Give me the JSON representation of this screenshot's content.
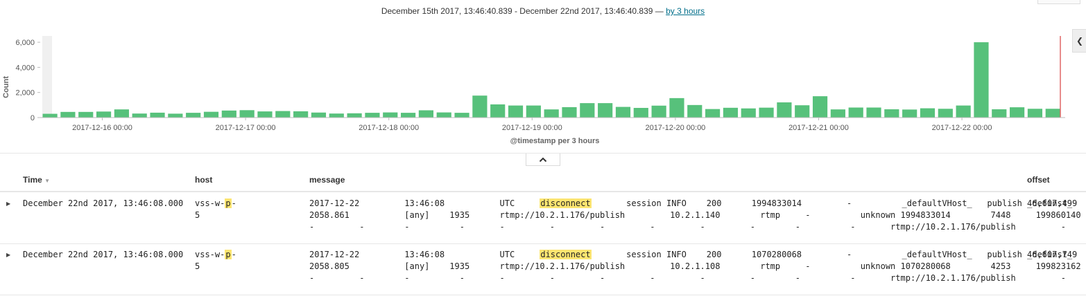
{
  "header": {
    "range_text": "December 15th 2017, 13:46:40.839 - December 22nd 2017, 13:46:40.839 —",
    "interval_link": "by 3 hours"
  },
  "chart_data": {
    "type": "bar",
    "ylabel": "Count",
    "xlabel": "@timestamp per 3 hours",
    "ylim": [
      0,
      6500
    ],
    "yticks": [
      0,
      2000,
      4000,
      6000
    ],
    "ytick_labels": [
      "0",
      "2,000",
      "4,000",
      "6,000"
    ],
    "xtick_labels": [
      "2017-12-16 00:00",
      "2017-12-17 00:00",
      "2017-12-18 00:00",
      "2017-12-19 00:00",
      "2017-12-20 00:00",
      "2017-12-21 00:00",
      "2017-12-22 00:00"
    ],
    "bar_color": "#57c17b",
    "values": [
      300,
      450,
      450,
      480,
      650,
      320,
      390,
      310,
      380,
      460,
      560,
      590,
      490,
      520,
      500,
      400,
      320,
      340,
      380,
      410,
      380,
      580,
      410,
      380,
      1750,
      1050,
      960,
      960,
      650,
      830,
      1150,
      1150,
      850,
      770,
      950,
      1550,
      1000,
      680,
      780,
      730,
      790,
      1210,
      980,
      1700,
      650,
      800,
      800,
      660,
      640,
      740,
      700,
      960,
      6000,
      660,
      820,
      700,
      700
    ]
  },
  "table": {
    "columns": {
      "time": "Time",
      "host": "host",
      "message": "message",
      "offset": "offset"
    },
    "rows": [
      {
        "time": "December 22nd 2017, 13:46:08.000",
        "host_pre": "vss-w-",
        "host_hl": "p",
        "host_post": "-",
        "host_line2": "5",
        "msg_l1_pre": "2017-12-22         13:46:08           UTC     ",
        "msg_l1_hl": "disconnect",
        "msg_l1_post": "       session INFO    200      1994833014         -          _defaultVHost_   publish _definst_",
        "msg_l2": "2058.861           [any]    1935      rtmp://10.2.1.176/publish         10.2.1.140        rtmp     -          unknown 1994833014        7448     199860140",
        "msg_l3": "-         -        -          -       -         -         -         -         -         -        -          -       rtmp://10.2.1.176/publish         -",
        "offset": "46,607,499"
      },
      {
        "time": "December 22nd 2017, 13:46:08.000",
        "host_pre": "vss-w-",
        "host_hl": "p",
        "host_post": "-",
        "host_line2": "5",
        "msg_l1_pre": "2017-12-22         13:46:08           UTC     ",
        "msg_l1_hl": "disconnect",
        "msg_l1_post": "       session INFO    200      1070280068         -          _defaultVHost_   publish _definst_",
        "msg_l2": "2058.805           [any]    1935      rtmp://10.2.1.176/publish         10.2.1.108        rtmp     -          unknown 1070280068        4253     199823162",
        "msg_l3": "-         -        -          -       -         -         -         -         -         -        -          -       rtmp://10.2.1.176/publish         -",
        "offset": "46,607,749"
      }
    ]
  }
}
